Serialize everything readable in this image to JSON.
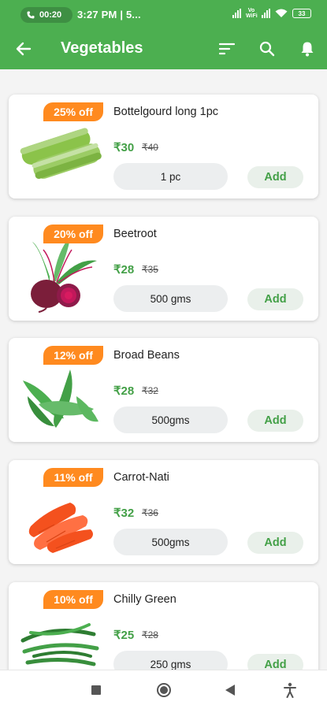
{
  "status_bar": {
    "call_timer": "00:20",
    "time": "3:27 PM | 5...",
    "network_label": "Vo WiFi",
    "battery": "33",
    "icons": [
      "phone-icon",
      "signal-icon",
      "wifi-icon",
      "battery-icon"
    ]
  },
  "app_bar": {
    "title": "Vegetables",
    "icons": [
      "back-arrow-icon",
      "sort-icon",
      "search-icon",
      "bell-icon"
    ],
    "accent_color": "#4caf50"
  },
  "products": [
    {
      "name": "Bottelgourd long 1pc",
      "discount": "25% off",
      "price": "₹30",
      "mrp": "₹40",
      "quantity": "1 pc",
      "add_label": "Add",
      "icon": "bottle-gourd-image"
    },
    {
      "name": "Beetroot",
      "discount": "20% off",
      "price": "₹28",
      "mrp": "₹35",
      "quantity": "500 gms",
      "add_label": "Add",
      "icon": "beetroot-image"
    },
    {
      "name": "Broad Beans",
      "discount": "12% off",
      "price": "₹28",
      "mrp": "₹32",
      "quantity": "500gms",
      "add_label": "Add",
      "icon": "broad-beans-image"
    },
    {
      "name": "Carrot-Nati",
      "discount": "11% off",
      "price": "₹32",
      "mrp": "₹36",
      "quantity": "500gms",
      "add_label": "Add",
      "icon": "carrot-image"
    },
    {
      "name": "Chilly Green",
      "discount": "10% off",
      "price": "₹25",
      "mrp": "₹28",
      "quantity": "250 gms",
      "add_label": "Add",
      "icon": "green-chilly-image"
    }
  ],
  "colors": {
    "discount_badge": "#ff8a1f",
    "price_green": "#43a047"
  },
  "system_nav": {
    "icons": [
      "recents-icon",
      "home-icon",
      "back-icon",
      "accessibility-icon"
    ]
  }
}
